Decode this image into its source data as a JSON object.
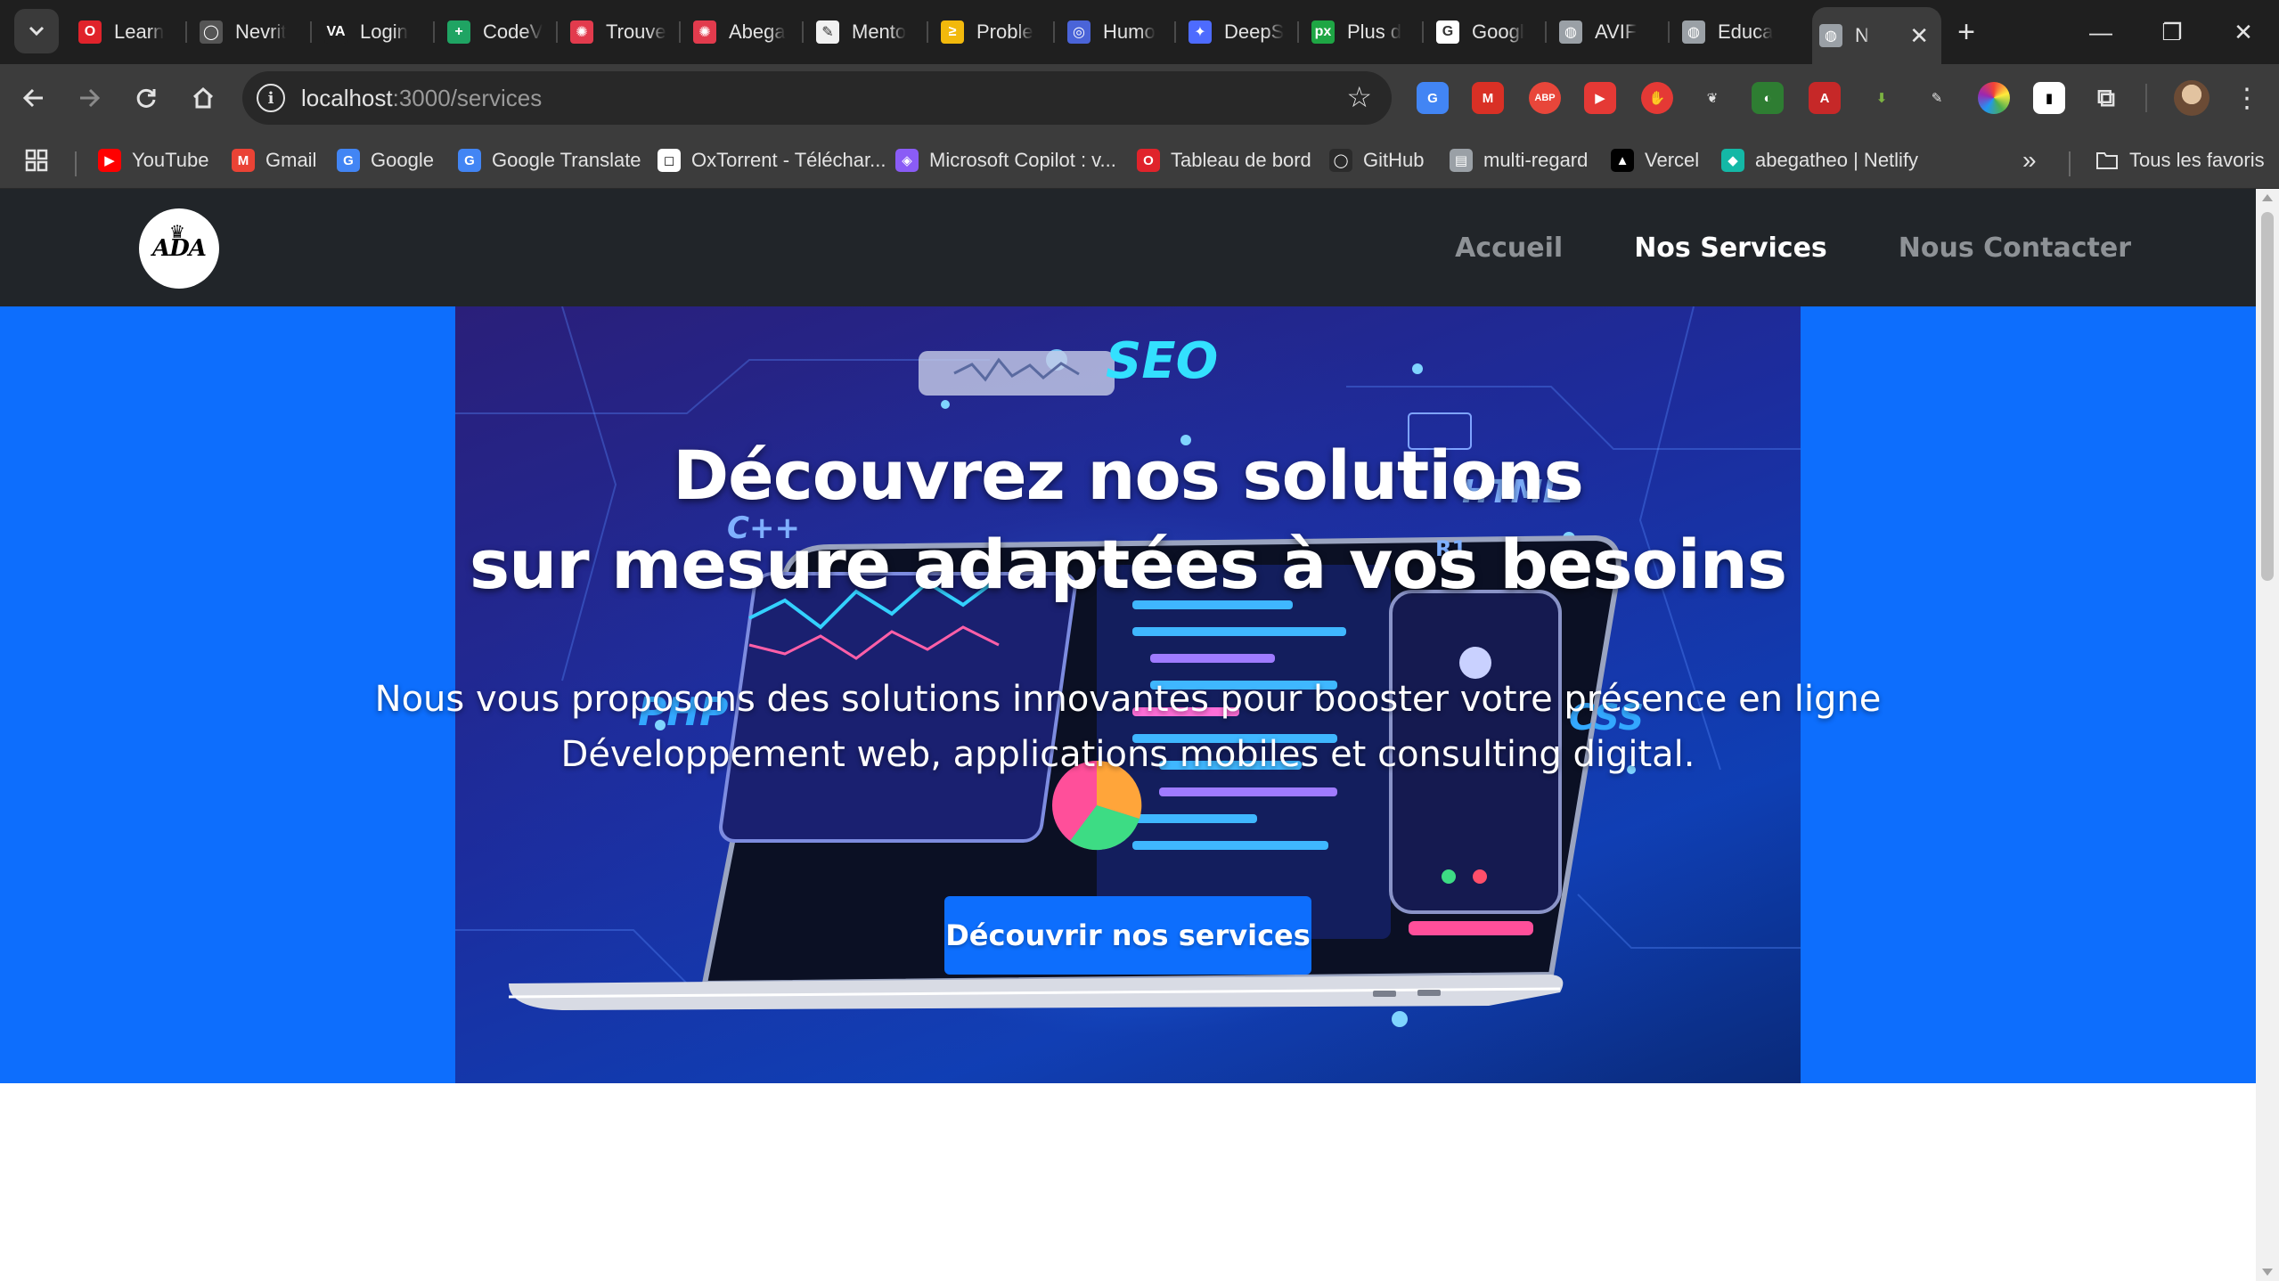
{
  "browser": {
    "tabs": [
      {
        "title": "Learn",
        "icon": "opera-icon",
        "color": "#e0232b"
      },
      {
        "title": "Nevrit",
        "icon": "github-icon",
        "color": "#555555"
      },
      {
        "title": "Login",
        "icon": "va-icon",
        "color": "#1f1f1f"
      },
      {
        "title": "CodeV",
        "icon": "sheets-icon",
        "color": "#1fa463"
      },
      {
        "title": "Trouve",
        "icon": "openai-icon",
        "color": "#e23b4d"
      },
      {
        "title": "Abega",
        "icon": "openai-icon",
        "color": "#e23b4d"
      },
      {
        "title": "Mento",
        "icon": "doc-icon",
        "color": "#f1f1f1"
      },
      {
        "title": "Proble",
        "icon": "codeforces-icon",
        "color": "#f2b90c"
      },
      {
        "title": "Humo",
        "icon": "human-icon",
        "color": "#4a64d8"
      },
      {
        "title": "DeepS",
        "icon": "deepseek-icon",
        "color": "#4d6bfe"
      },
      {
        "title": "Plus d",
        "icon": "px-icon",
        "color": "#1ea644"
      },
      {
        "title": "Googl",
        "icon": "google-icon",
        "color": "#ffffff"
      },
      {
        "title": "AVIF",
        "icon": "globe-icon",
        "color": "#9aa0a6"
      },
      {
        "title": "Educa",
        "icon": "globe-icon",
        "color": "#9aa0a6"
      },
      {
        "title": "N",
        "icon": "globe-icon",
        "color": "#9aa0a6",
        "active": true
      }
    ],
    "new_tab_symbol": "+",
    "window_controls": {
      "minimize": "—",
      "restore": "❐",
      "close": "✕"
    },
    "url": {
      "host": "localhost",
      "rest": ":3000/services"
    },
    "bookmarks": [
      {
        "label": "YouTube",
        "icon": "youtube-icon",
        "color": "#ff0000"
      },
      {
        "label": "Gmail",
        "icon": "gmail-icon",
        "color": "#ea4335"
      },
      {
        "label": "Google",
        "icon": "google-icon",
        "color": "#4285f4"
      },
      {
        "label": "Google Translate",
        "icon": "translate-icon",
        "color": "#4285f4"
      },
      {
        "label": "OxTorrent - Téléchar...",
        "icon": "oxtorrent-icon",
        "color": "#ffffff"
      },
      {
        "label": "Microsoft Copilot : v...",
        "icon": "copilot-icon",
        "color": "#8a5cf6"
      },
      {
        "label": "Tableau de bord",
        "icon": "opera-icon",
        "color": "#e0232b"
      },
      {
        "label": "GitHub",
        "icon": "github-icon",
        "color": "#2b2b2b"
      },
      {
        "label": "multi-regard",
        "icon": "file-icon",
        "color": "#9aa0a6"
      },
      {
        "label": "Vercel",
        "icon": "vercel-icon",
        "color": "#000000"
      },
      {
        "label": "abegatheo | Netlify",
        "icon": "netlify-icon",
        "color": "#14b8a6"
      }
    ],
    "bookmarks_more": "»",
    "all_bookmarks": "Tous les favoris"
  },
  "site": {
    "logo_text": "ADA",
    "nav": [
      {
        "label": "Accueil",
        "active": false
      },
      {
        "label": "Nos Services",
        "active": true
      },
      {
        "label": "Nous Contacter",
        "active": false
      }
    ],
    "hero": {
      "title_line1": "Découvrez nos solutions",
      "title_line2": "sur mesure adaptées à vos besoins",
      "subtitle_line1": "Nous vous proposons des solutions innovantes pour booster votre présence en ligne",
      "subtitle_line2": "Développement web, applications mobiles et consulting digital.",
      "cta": "Découvrir nos services",
      "image_words": {
        "seo": "SEO",
        "php": "PHP",
        "css": "CSS",
        "html": "HTML",
        "cpp": "C++",
        "r1": "R1"
      }
    },
    "colors": {
      "navbar": "#212529",
      "primary": "#0d6efd"
    }
  }
}
